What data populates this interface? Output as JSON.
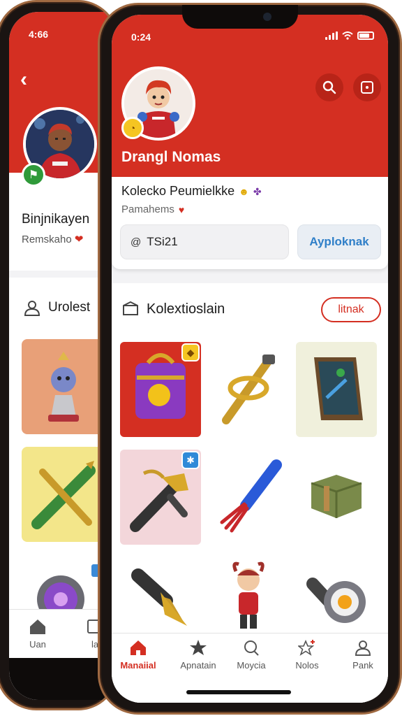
{
  "back_phone": {
    "status_time": "4:66",
    "name": "Binjnikayen",
    "subtitle": "Remskaho",
    "section_title": "Urolest",
    "tabs": [
      {
        "label": "Uan",
        "icon": "home-icon"
      },
      {
        "label": "la",
        "icon": "collection-icon"
      }
    ]
  },
  "front_phone": {
    "status_time": "0:24",
    "username": "Drangl Nomas",
    "card_line1": "Kolecko Peumielkke",
    "card_line2": "Pamahems",
    "code_value": "TSi21",
    "apply_label": "Ayploknak",
    "section_title": "Kolextioslain",
    "section_pill": "litnak",
    "tabs": [
      {
        "label": "Manaiial",
        "icon": "home-icon",
        "active": true
      },
      {
        "label": "Apnatain",
        "icon": "star-icon"
      },
      {
        "label": "Moycia",
        "icon": "search-icon"
      },
      {
        "label": "Nolos",
        "icon": "star-plus-icon"
      },
      {
        "label": "Pank",
        "icon": "person-icon"
      }
    ]
  },
  "colors": {
    "accent_red": "#d42f22",
    "link_blue": "#2f7fc8",
    "badge_yellow": "#f5c522",
    "badge_green": "#2f9a3a"
  }
}
